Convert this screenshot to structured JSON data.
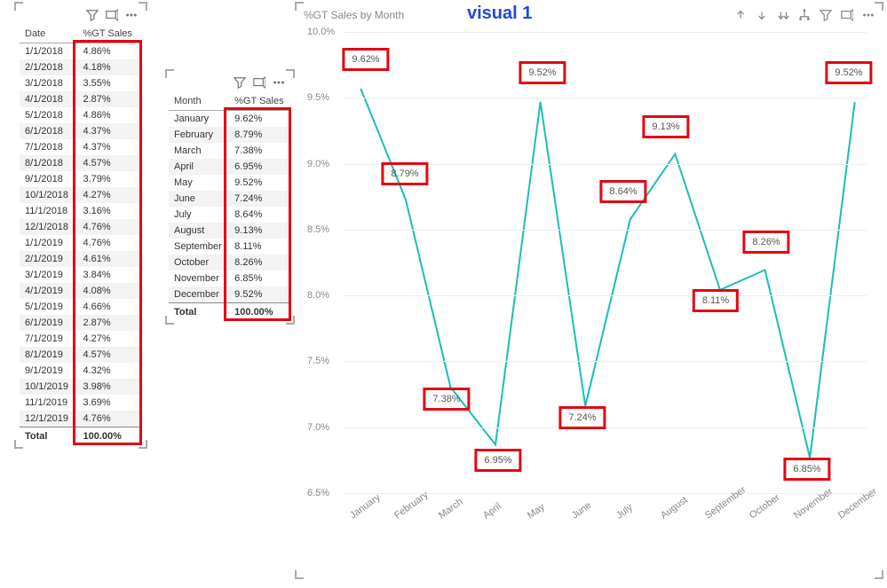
{
  "table_date": {
    "headers": [
      "Date",
      "%GT Sales"
    ],
    "rows": [
      [
        "1/1/2018",
        "4.86%"
      ],
      [
        "2/1/2018",
        "4.18%"
      ],
      [
        "3/1/2018",
        "3.55%"
      ],
      [
        "4/1/2018",
        "2.87%"
      ],
      [
        "5/1/2018",
        "4.86%"
      ],
      [
        "6/1/2018",
        "4.37%"
      ],
      [
        "7/1/2018",
        "4.37%"
      ],
      [
        "8/1/2018",
        "4.57%"
      ],
      [
        "9/1/2018",
        "3.79%"
      ],
      [
        "10/1/2018",
        "4.27%"
      ],
      [
        "11/1/2018",
        "3.16%"
      ],
      [
        "12/1/2018",
        "4.76%"
      ],
      [
        "1/1/2019",
        "4.76%"
      ],
      [
        "2/1/2019",
        "4.61%"
      ],
      [
        "3/1/2019",
        "3.84%"
      ],
      [
        "4/1/2019",
        "4.08%"
      ],
      [
        "5/1/2019",
        "4.66%"
      ],
      [
        "6/1/2019",
        "2.87%"
      ],
      [
        "7/1/2019",
        "4.27%"
      ],
      [
        "8/1/2019",
        "4.57%"
      ],
      [
        "9/1/2019",
        "4.32%"
      ],
      [
        "10/1/2019",
        "3.98%"
      ],
      [
        "11/1/2019",
        "3.69%"
      ],
      [
        "12/1/2019",
        "4.76%"
      ]
    ],
    "total_label": "Total",
    "total_value": "100.00%"
  },
  "table_month": {
    "headers": [
      "Month",
      "%GT Sales"
    ],
    "rows": [
      [
        "January",
        "9.62%"
      ],
      [
        "February",
        "8.79%"
      ],
      [
        "March",
        "7.38%"
      ],
      [
        "April",
        "6.95%"
      ],
      [
        "May",
        "9.52%"
      ],
      [
        "June",
        "7.24%"
      ],
      [
        "July",
        "8.64%"
      ],
      [
        "August",
        "9.13%"
      ],
      [
        "September",
        "8.11%"
      ],
      [
        "October",
        "8.26%"
      ],
      [
        "November",
        "6.85%"
      ],
      [
        "December",
        "9.52%"
      ]
    ],
    "total_label": "Total",
    "total_value": "100.00%"
  },
  "chart_data": {
    "type": "line",
    "title": "%GT Sales by Month",
    "overlay_label": "visual 1",
    "categories": [
      "January",
      "February",
      "March",
      "April",
      "May",
      "June",
      "July",
      "August",
      "September",
      "October",
      "November",
      "December"
    ],
    "values": [
      9.62,
      8.79,
      7.38,
      6.95,
      9.52,
      7.24,
      8.64,
      9.13,
      8.11,
      8.26,
      6.85,
      9.52
    ],
    "value_labels": [
      "9.62%",
      "8.79%",
      "7.38%",
      "6.95%",
      "9.52%",
      "7.24%",
      "8.64%",
      "9.13%",
      "8.11%",
      "8.26%",
      "6.85%",
      "9.52%"
    ],
    "ylabel": "",
    "xlabel": "",
    "ylim": [
      6.5,
      10.0
    ],
    "yticks": [
      6.5,
      7.0,
      7.5,
      8.0,
      8.5,
      9.0,
      9.5,
      10.0
    ],
    "ytick_labels": [
      "6.5%",
      "7.0%",
      "7.5%",
      "8.0%",
      "8.5%",
      "9.0%",
      "9.5%",
      "10.0%"
    ],
    "label_voffset": [
      -25,
      -20,
      25,
      30,
      -25,
      25,
      -22,
      -22,
      22,
      -22,
      25,
      -25
    ],
    "label_hoffset": [
      6,
      0,
      -3,
      5,
      5,
      0,
      -4,
      -6,
      0,
      7,
      3,
      0
    ]
  }
}
